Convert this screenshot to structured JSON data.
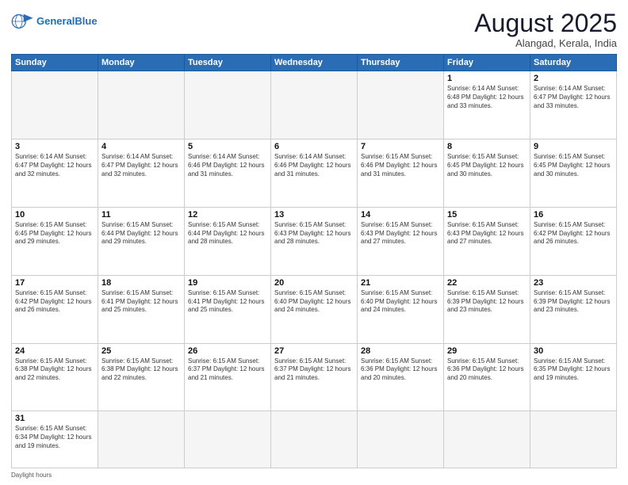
{
  "header": {
    "logo_general": "General",
    "logo_blue": "Blue",
    "month_title": "August 2025",
    "subtitle": "Alangad, Kerala, India"
  },
  "days_of_week": [
    "Sunday",
    "Monday",
    "Tuesday",
    "Wednesday",
    "Thursday",
    "Friday",
    "Saturday"
  ],
  "weeks": [
    [
      {
        "day": "",
        "info": ""
      },
      {
        "day": "",
        "info": ""
      },
      {
        "day": "",
        "info": ""
      },
      {
        "day": "",
        "info": ""
      },
      {
        "day": "",
        "info": ""
      },
      {
        "day": "1",
        "info": "Sunrise: 6:14 AM\nSunset: 6:48 PM\nDaylight: 12 hours\nand 33 minutes."
      },
      {
        "day": "2",
        "info": "Sunrise: 6:14 AM\nSunset: 6:47 PM\nDaylight: 12 hours\nand 33 minutes."
      }
    ],
    [
      {
        "day": "3",
        "info": "Sunrise: 6:14 AM\nSunset: 6:47 PM\nDaylight: 12 hours\nand 32 minutes."
      },
      {
        "day": "4",
        "info": "Sunrise: 6:14 AM\nSunset: 6:47 PM\nDaylight: 12 hours\nand 32 minutes."
      },
      {
        "day": "5",
        "info": "Sunrise: 6:14 AM\nSunset: 6:46 PM\nDaylight: 12 hours\nand 31 minutes."
      },
      {
        "day": "6",
        "info": "Sunrise: 6:14 AM\nSunset: 6:46 PM\nDaylight: 12 hours\nand 31 minutes."
      },
      {
        "day": "7",
        "info": "Sunrise: 6:15 AM\nSunset: 6:46 PM\nDaylight: 12 hours\nand 31 minutes."
      },
      {
        "day": "8",
        "info": "Sunrise: 6:15 AM\nSunset: 6:45 PM\nDaylight: 12 hours\nand 30 minutes."
      },
      {
        "day": "9",
        "info": "Sunrise: 6:15 AM\nSunset: 6:45 PM\nDaylight: 12 hours\nand 30 minutes."
      }
    ],
    [
      {
        "day": "10",
        "info": "Sunrise: 6:15 AM\nSunset: 6:45 PM\nDaylight: 12 hours\nand 29 minutes."
      },
      {
        "day": "11",
        "info": "Sunrise: 6:15 AM\nSunset: 6:44 PM\nDaylight: 12 hours\nand 29 minutes."
      },
      {
        "day": "12",
        "info": "Sunrise: 6:15 AM\nSunset: 6:44 PM\nDaylight: 12 hours\nand 28 minutes."
      },
      {
        "day": "13",
        "info": "Sunrise: 6:15 AM\nSunset: 6:43 PM\nDaylight: 12 hours\nand 28 minutes."
      },
      {
        "day": "14",
        "info": "Sunrise: 6:15 AM\nSunset: 6:43 PM\nDaylight: 12 hours\nand 27 minutes."
      },
      {
        "day": "15",
        "info": "Sunrise: 6:15 AM\nSunset: 6:43 PM\nDaylight: 12 hours\nand 27 minutes."
      },
      {
        "day": "16",
        "info": "Sunrise: 6:15 AM\nSunset: 6:42 PM\nDaylight: 12 hours\nand 26 minutes."
      }
    ],
    [
      {
        "day": "17",
        "info": "Sunrise: 6:15 AM\nSunset: 6:42 PM\nDaylight: 12 hours\nand 26 minutes."
      },
      {
        "day": "18",
        "info": "Sunrise: 6:15 AM\nSunset: 6:41 PM\nDaylight: 12 hours\nand 25 minutes."
      },
      {
        "day": "19",
        "info": "Sunrise: 6:15 AM\nSunset: 6:41 PM\nDaylight: 12 hours\nand 25 minutes."
      },
      {
        "day": "20",
        "info": "Sunrise: 6:15 AM\nSunset: 6:40 PM\nDaylight: 12 hours\nand 24 minutes."
      },
      {
        "day": "21",
        "info": "Sunrise: 6:15 AM\nSunset: 6:40 PM\nDaylight: 12 hours\nand 24 minutes."
      },
      {
        "day": "22",
        "info": "Sunrise: 6:15 AM\nSunset: 6:39 PM\nDaylight: 12 hours\nand 23 minutes."
      },
      {
        "day": "23",
        "info": "Sunrise: 6:15 AM\nSunset: 6:39 PM\nDaylight: 12 hours\nand 23 minutes."
      }
    ],
    [
      {
        "day": "24",
        "info": "Sunrise: 6:15 AM\nSunset: 6:38 PM\nDaylight: 12 hours\nand 22 minutes."
      },
      {
        "day": "25",
        "info": "Sunrise: 6:15 AM\nSunset: 6:38 PM\nDaylight: 12 hours\nand 22 minutes."
      },
      {
        "day": "26",
        "info": "Sunrise: 6:15 AM\nSunset: 6:37 PM\nDaylight: 12 hours\nand 21 minutes."
      },
      {
        "day": "27",
        "info": "Sunrise: 6:15 AM\nSunset: 6:37 PM\nDaylight: 12 hours\nand 21 minutes."
      },
      {
        "day": "28",
        "info": "Sunrise: 6:15 AM\nSunset: 6:36 PM\nDaylight: 12 hours\nand 20 minutes."
      },
      {
        "day": "29",
        "info": "Sunrise: 6:15 AM\nSunset: 6:36 PM\nDaylight: 12 hours\nand 20 minutes."
      },
      {
        "day": "30",
        "info": "Sunrise: 6:15 AM\nSunset: 6:35 PM\nDaylight: 12 hours\nand 19 minutes."
      }
    ],
    [
      {
        "day": "31",
        "info": "Sunrise: 6:15 AM\nSunset: 6:34 PM\nDaylight: 12 hours\nand 19 minutes."
      },
      {
        "day": "",
        "info": ""
      },
      {
        "day": "",
        "info": ""
      },
      {
        "day": "",
        "info": ""
      },
      {
        "day": "",
        "info": ""
      },
      {
        "day": "",
        "info": ""
      },
      {
        "day": "",
        "info": ""
      }
    ]
  ],
  "footer": {
    "daylight_label": "Daylight hours"
  }
}
